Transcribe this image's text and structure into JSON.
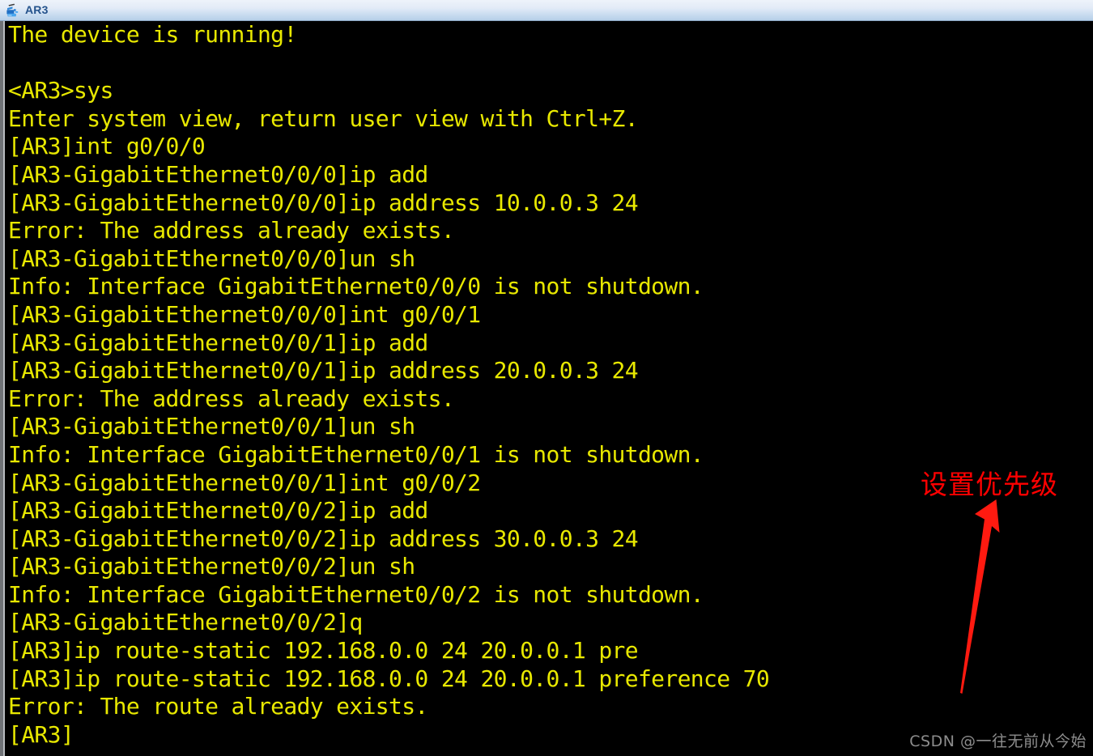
{
  "window": {
    "title": "AR3",
    "icon": "router-device-icon"
  },
  "terminal": {
    "foreground_color": "#e8e800",
    "background_color": "#000000",
    "lines": [
      "The device is running!",
      "",
      "<AR3>sys",
      "Enter system view, return user view with Ctrl+Z.",
      "[AR3]int g0/0/0",
      "[AR3-GigabitEthernet0/0/0]ip add",
      "[AR3-GigabitEthernet0/0/0]ip address 10.0.0.3 24",
      "Error: The address already exists.",
      "[AR3-GigabitEthernet0/0/0]un sh",
      "Info: Interface GigabitEthernet0/0/0 is not shutdown.",
      "[AR3-GigabitEthernet0/0/0]int g0/0/1",
      "[AR3-GigabitEthernet0/0/1]ip add",
      "[AR3-GigabitEthernet0/0/1]ip address 20.0.0.3 24",
      "Error: The address already exists.",
      "[AR3-GigabitEthernet0/0/1]un sh",
      "Info: Interface GigabitEthernet0/0/1 is not shutdown.",
      "[AR3-GigabitEthernet0/0/1]int g0/0/2",
      "[AR3-GigabitEthernet0/0/2]ip add",
      "[AR3-GigabitEthernet0/0/2]ip address 30.0.0.3 24",
      "[AR3-GigabitEthernet0/0/2]un sh",
      "Info: Interface GigabitEthernet0/0/2 is not shutdown.",
      "[AR3-GigabitEthernet0/0/2]q",
      "[AR3]ip route-static 192.168.0.0 24 20.0.0.1 pre",
      "[AR3]ip route-static 192.168.0.0 24 20.0.0.1 preference 70",
      "Error: The route already exists.",
      "[AR3]"
    ]
  },
  "annotation": {
    "text": "设置优先级",
    "color": "#ff0000",
    "arrow": "up-right-arrow-icon"
  },
  "watermark": {
    "text": "CSDN @一往无前从今始",
    "color": "#8d8d8d"
  }
}
